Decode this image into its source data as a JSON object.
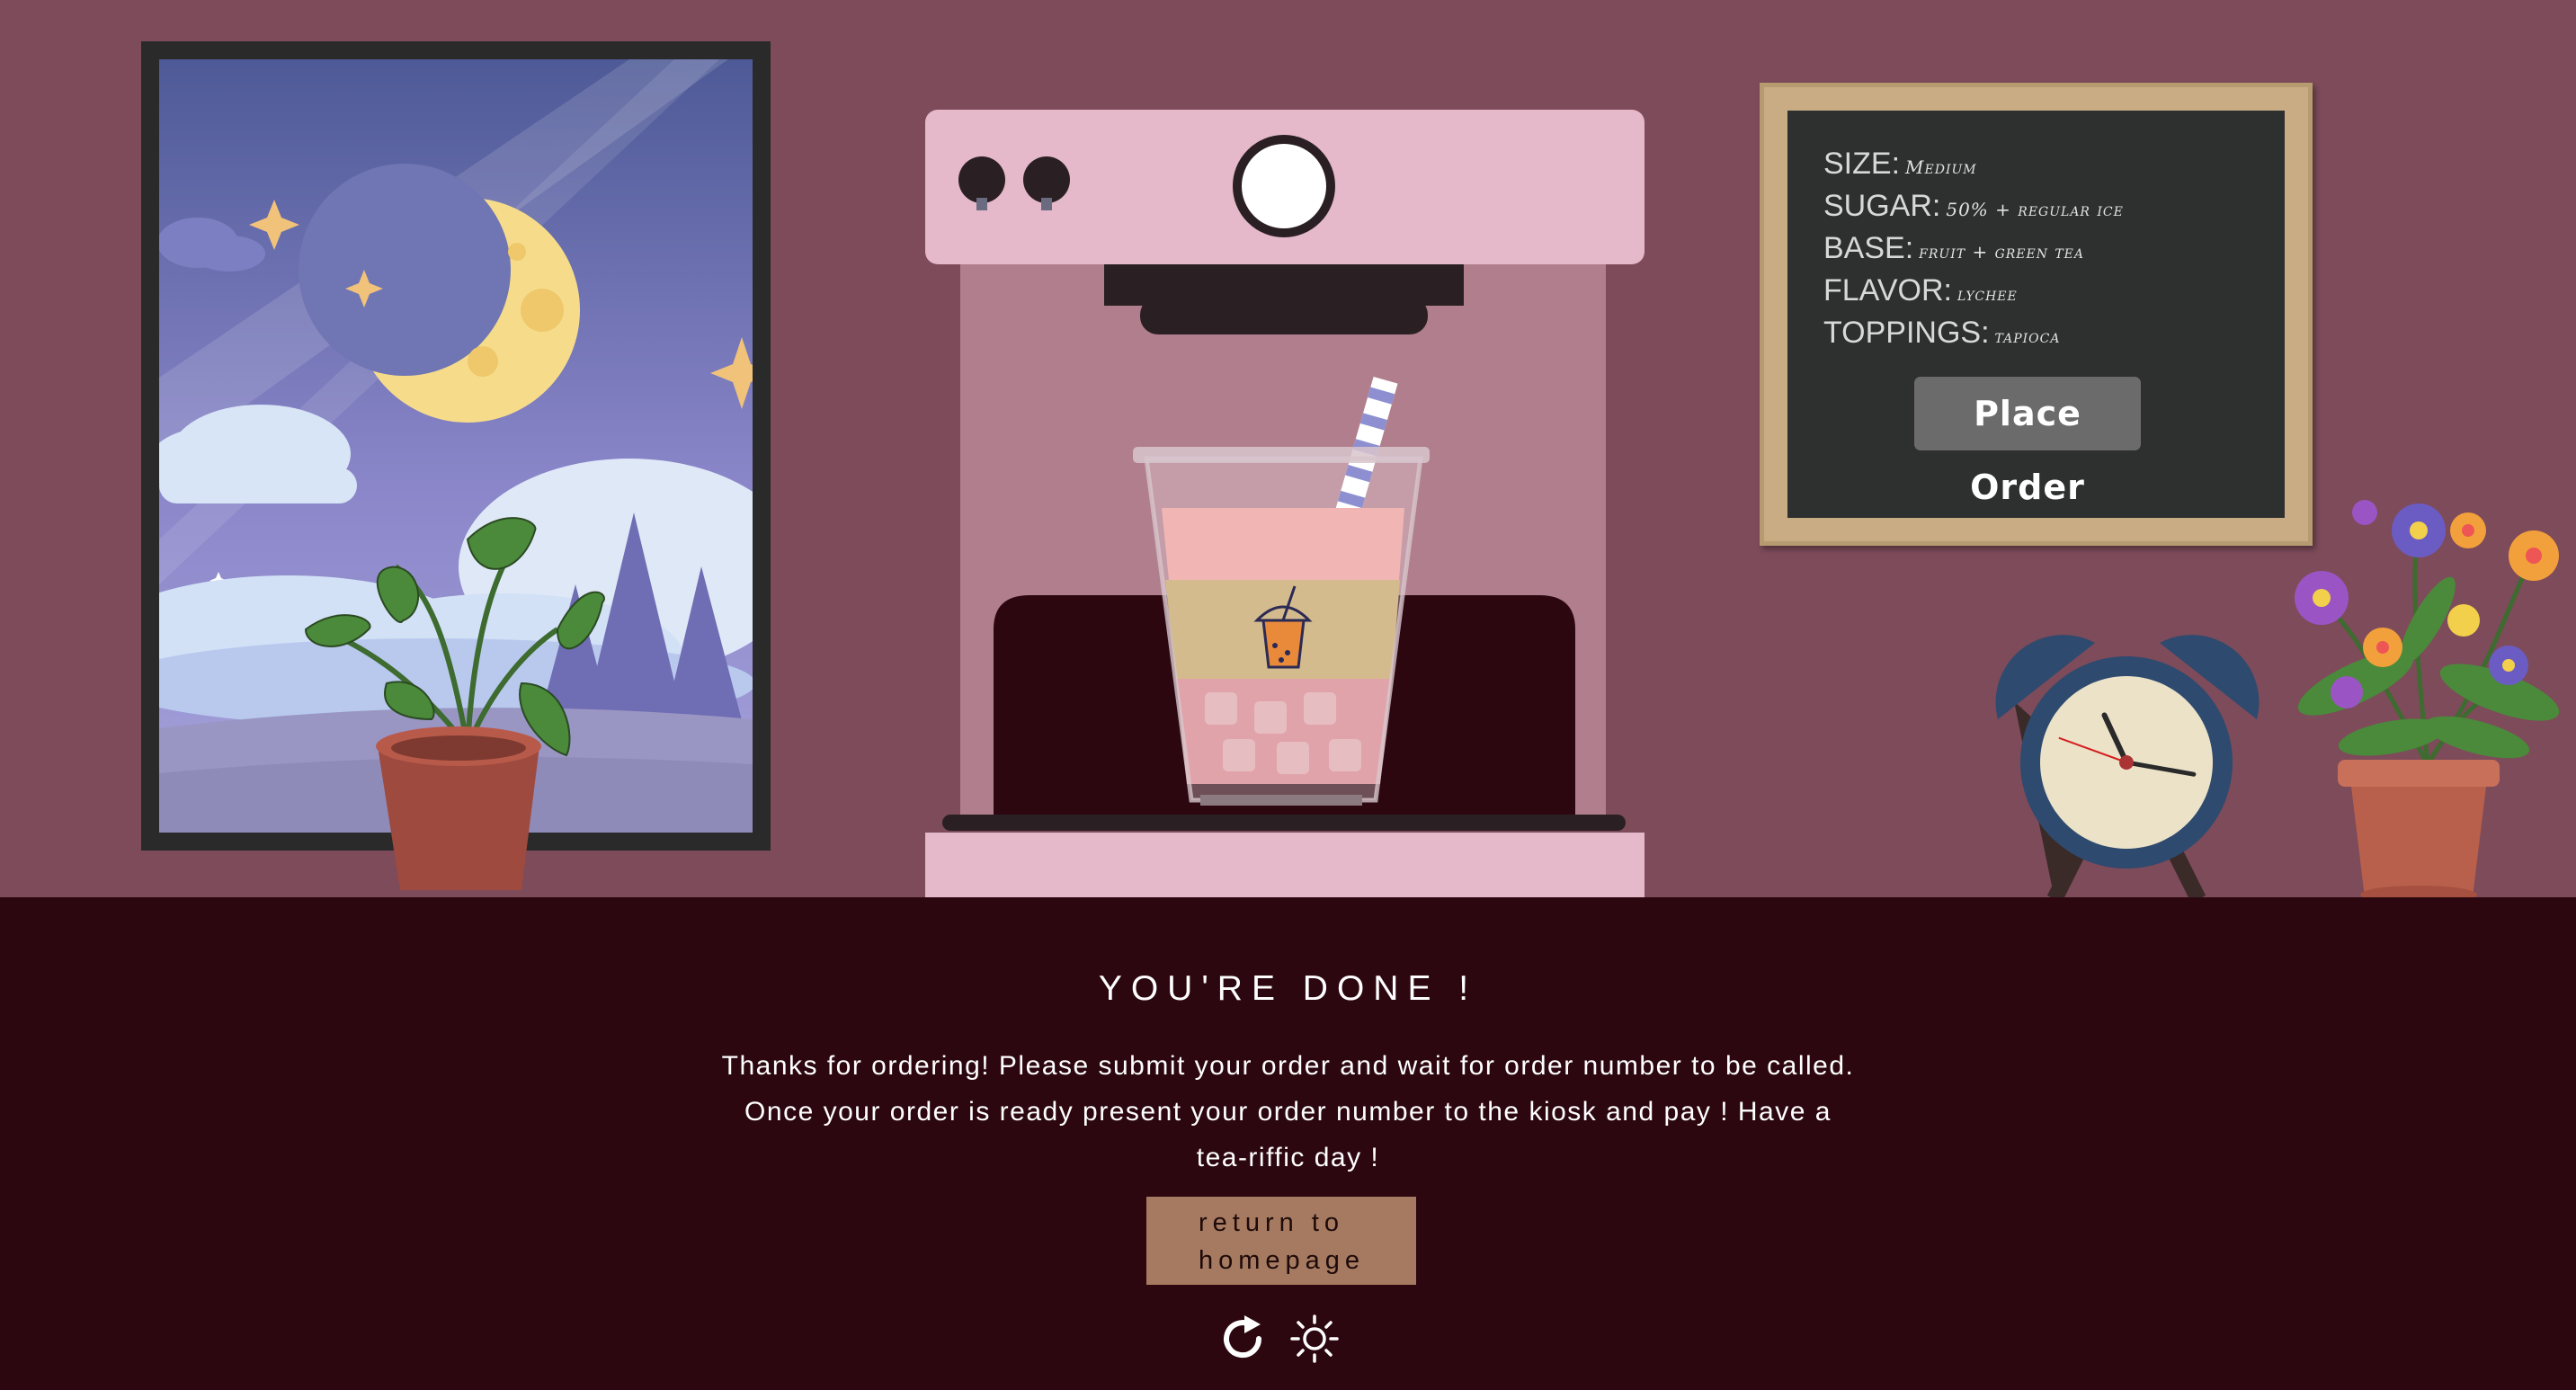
{
  "colors": {
    "wall": "#7d4b5a",
    "floor": "#2c0710",
    "machine_pink": "#e5b8ca",
    "machine_body": "#b07e8c",
    "board_frame": "#c9ac84",
    "board": "#2e2f2f",
    "button_grey": "#6b6b6b",
    "return_button": "#a57a60"
  },
  "menu": {
    "size_label": "SIZE:",
    "size_value": "Medium",
    "sugar_label": "SUGAR:",
    "sugar_value": "50% + regular ice",
    "base_label": "BASE:",
    "base_value": "fruit + green tea",
    "flavor_label": "FLAVOR:",
    "flavor_value": "lychee",
    "toppings_label": "TOPPINGS:",
    "toppings_value": "tapioca",
    "place_order": "Place Order"
  },
  "done": {
    "heading": "YOU'RE DONE !",
    "message": "Thanks for ordering! Please submit your order and wait for order number to be called. Once your order is ready present your order number to the kiosk and pay ! Have a tea-riffic day !",
    "return_line1": "return to",
    "return_line2": "homepage"
  },
  "icons": {
    "restart": "restart-icon",
    "theme": "sun-icon"
  },
  "clock": {
    "hour_hand_deg": -25,
    "minute_hand_deg": 100,
    "second_hand_deg": -70
  }
}
